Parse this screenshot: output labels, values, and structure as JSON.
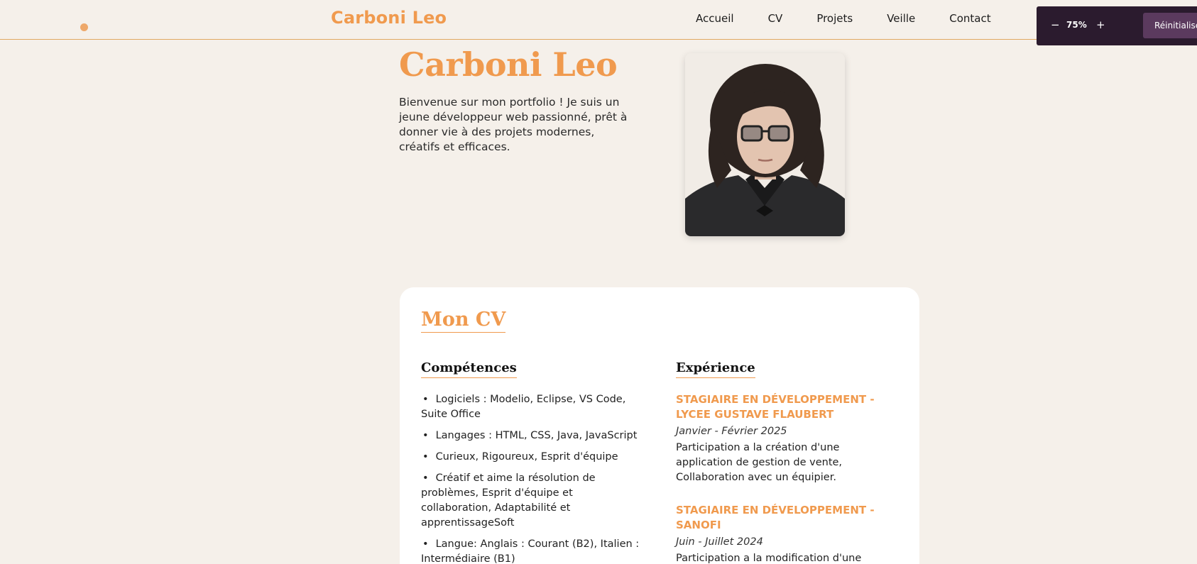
{
  "header": {
    "brand": "Carboni Leo",
    "nav": [
      "Accueil",
      "CV",
      "Projets",
      "Veille",
      "Contact"
    ]
  },
  "zoom": {
    "minus": "−",
    "value": "75%",
    "plus": "+",
    "reset": "Réinitialiser"
  },
  "hero": {
    "title": "Carboni Leo",
    "intro": "Bienvenue sur mon portfolio ! Je suis un jeune développeur web passionné, prêt à donner vie à des projets modernes, créatifs et efficaces."
  },
  "cv": {
    "title": "Mon CV",
    "skills_title": "Compétences",
    "skills": [
      "Logiciels : Modelio, Eclipse, VS Code, Suite Office",
      "Langages : HTML, CSS, Java, JavaScript",
      "Curieux, Rigoureux, Esprit d'équipe",
      "Créatif et aime la résolution de problèmes, Esprit d'équipe et collaboration, Adaptabilité et apprentissageSoft",
      "Langue: Anglais : Courant (B2), Italien : Intermédiaire (B1)"
    ],
    "experience_title": "Expérience",
    "experience": [
      {
        "role": "Stagiaire en Développement - Lycee Gustave Flaubert",
        "date": "Janvier - Février 2025",
        "desc": "Participation a la création d'une application de gestion de vente, Collaboration avec un équipier."
      },
      {
        "role": "Stagiaire en Développement - Sanofi",
        "date": "Juin - Juillet 2024",
        "desc": "Participation a la modification d'une"
      }
    ]
  },
  "colors": {
    "accent": "#f09a4e",
    "background": "#f5f0ea",
    "zoombar": "#2b1b2e"
  }
}
